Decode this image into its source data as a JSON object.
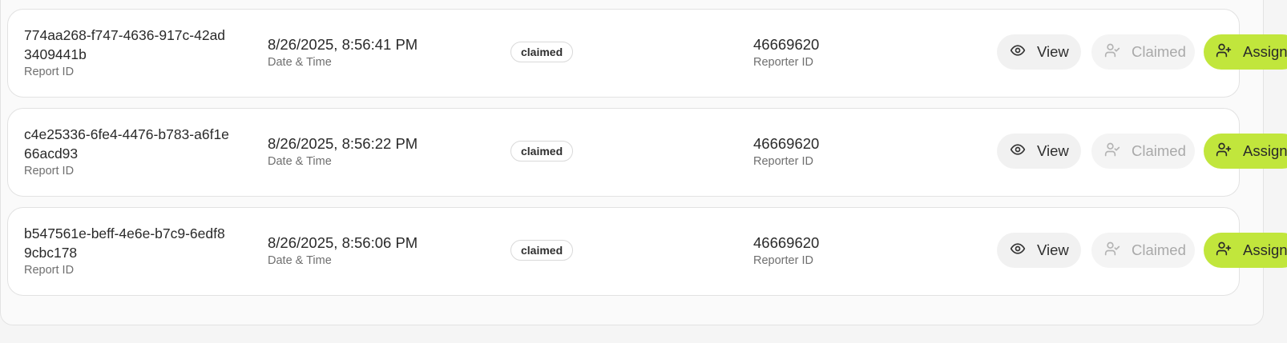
{
  "reports": [
    {
      "report_id": "774aa268-f747-4636-917c-42ad3409441b",
      "report_id_label": "Report ID",
      "date_time": "8/26/2025, 8:56:41 PM",
      "date_time_label": "Date & Time",
      "status": "claimed",
      "reporter_id": "46669620",
      "reporter_id_label": "Reporter ID",
      "view_label": "View",
      "claimed_label": "Claimed",
      "assign_label": "Assign"
    },
    {
      "report_id": "c4e25336-6fe4-4476-b783-a6f1e66acd93",
      "report_id_label": "Report ID",
      "date_time": "8/26/2025, 8:56:22 PM",
      "date_time_label": "Date & Time",
      "status": "claimed",
      "reporter_id": "46669620",
      "reporter_id_label": "Reporter ID",
      "view_label": "View",
      "claimed_label": "Claimed",
      "assign_label": "Assign"
    },
    {
      "report_id": "b547561e-beff-4e6e-b7c9-6edf89cbc178",
      "report_id_label": "Report ID",
      "date_time": "8/26/2025, 8:56:06 PM",
      "date_time_label": "Date & Time",
      "status": "claimed",
      "reporter_id": "46669620",
      "reporter_id_label": "Reporter ID",
      "view_label": "View",
      "claimed_label": "Claimed",
      "assign_label": "Assign"
    }
  ],
  "icons": {
    "view": "eye-icon",
    "claimed": "user-check-icon",
    "assign": "user-plus-icon"
  },
  "colors": {
    "assign_accent": "#c1e63c",
    "view_bg": "#f1f1f1",
    "claimed_disabled_text": "#a9a9a9"
  }
}
